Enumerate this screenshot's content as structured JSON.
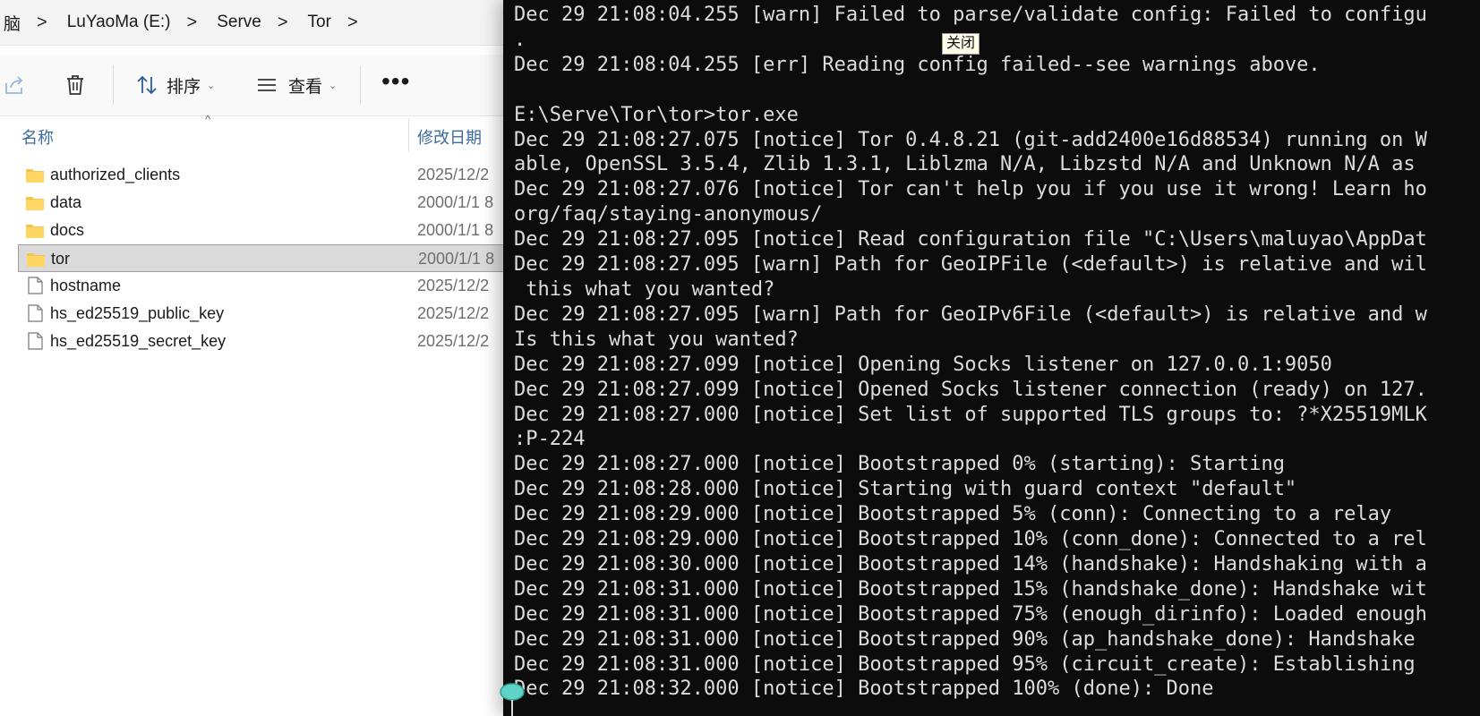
{
  "explorer": {
    "breadcrumbs": [
      {
        "label": "脑"
      },
      {
        "label": "LuYaoMa (E:)"
      },
      {
        "label": "Serve"
      },
      {
        "label": "Tor"
      }
    ],
    "breadcrumb_separator": ">",
    "toolbar": {
      "sort_label": "排序",
      "view_label": "查看",
      "more_label": "•••"
    },
    "columns": {
      "name": "名称",
      "date_modified": "修改日期"
    },
    "files": [
      {
        "name": "authorized_clients",
        "date": "2025/12/2",
        "type": "folder",
        "selected": false
      },
      {
        "name": "data",
        "date": "2000/1/1 8",
        "type": "folder",
        "selected": false
      },
      {
        "name": "docs",
        "date": "2000/1/1 8",
        "type": "folder",
        "selected": false
      },
      {
        "name": "tor",
        "date": "2000/1/1 8",
        "type": "folder",
        "selected": true
      },
      {
        "name": "hostname",
        "date": "2025/12/2",
        "type": "file",
        "selected": false
      },
      {
        "name": "hs_ed25519_public_key",
        "date": "2025/12/2",
        "type": "file",
        "selected": false
      },
      {
        "name": "hs_ed25519_secret_key",
        "date": "2025/12/2",
        "type": "file",
        "selected": false
      }
    ]
  },
  "console": {
    "tooltip": "关闭",
    "lines": [
      "Dec 29 21:08:04.255 [warn] Failed to parse/validate config: Failed to configu",
      ".",
      "Dec 29 21:08:04.255 [err] Reading config failed--see warnings above.",
      "",
      "E:\\Serve\\Tor\\tor>tor.exe",
      "Dec 29 21:08:27.075 [notice] Tor 0.4.8.21 (git-add2400e16d88534) running on W",
      "able, OpenSSL 3.5.4, Zlib 1.3.1, Liblzma N/A, Libzstd N/A and Unknown N/A as ",
      "Dec 29 21:08:27.076 [notice] Tor can't help you if you use it wrong! Learn ho",
      "org/faq/staying-anonymous/",
      "Dec 29 21:08:27.095 [notice] Read configuration file \"C:\\Users\\maluyao\\AppDat",
      "Dec 29 21:08:27.095 [warn] Path for GeoIPFile (<default>) is relative and wil",
      " this what you wanted?",
      "Dec 29 21:08:27.095 [warn] Path for GeoIPv6File (<default>) is relative and w",
      "Is this what you wanted?",
      "Dec 29 21:08:27.099 [notice] Opening Socks listener on 127.0.0.1:9050",
      "Dec 29 21:08:27.099 [notice] Opened Socks listener connection (ready) on 127.",
      "Dec 29 21:08:27.000 [notice] Set list of supported TLS groups to: ?*X25519MLK",
      ":P-224",
      "Dec 29 21:08:27.000 [notice] Bootstrapped 0% (starting): Starting",
      "Dec 29 21:08:28.000 [notice] Starting with guard context \"default\"",
      "Dec 29 21:08:29.000 [notice] Bootstrapped 5% (conn): Connecting to a relay",
      "Dec 29 21:08:29.000 [notice] Bootstrapped 10% (conn_done): Connected to a rel",
      "Dec 29 21:08:30.000 [notice] Bootstrapped 14% (handshake): Handshaking with a",
      "Dec 29 21:08:31.000 [notice] Bootstrapped 15% (handshake_done): Handshake wit",
      "Dec 29 21:08:31.000 [notice] Bootstrapped 75% (enough_dirinfo): Loaded enough",
      "Dec 29 21:08:31.000 [notice] Bootstrapped 90% (ap_handshake_done): Handshake ",
      "Dec 29 21:08:31.000 [notice] Bootstrapped 95% (circuit_create): Establishing ",
      "Dec 29 21:08:32.000 [notice] Bootstrapped 100% (done): Done"
    ]
  },
  "colors": {
    "console_bg": "#0c0c0c",
    "console_text": "#dcdcdc",
    "folder": "#f7c34a",
    "selection": "#dadada",
    "header_text": "#3b6aa0"
  }
}
